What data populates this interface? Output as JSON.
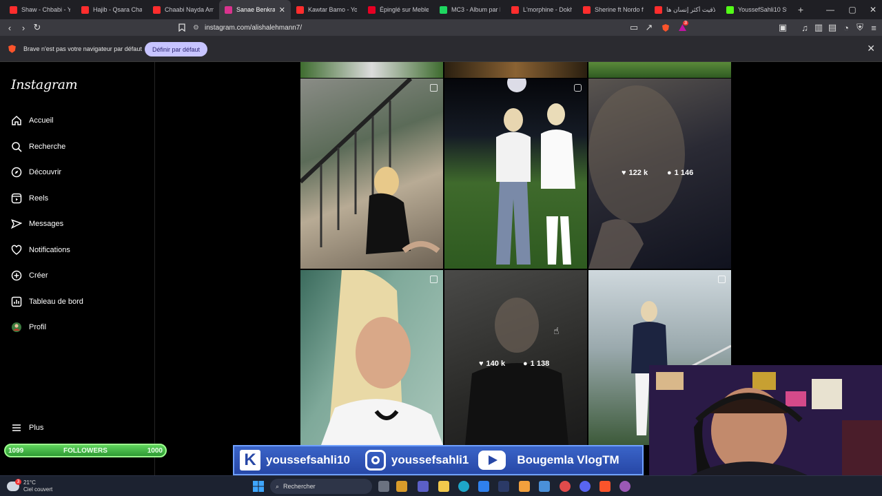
{
  "browser": {
    "tabs": [
      {
        "title": "Shaw - Chbabi - Yo",
        "color": "#ff2d2d"
      },
      {
        "title": "Hajib - Qsara Chaab",
        "color": "#ff2d2d"
      },
      {
        "title": "Chaabi Nayda Amb",
        "color": "#ff2d2d"
      },
      {
        "title": "Sanae Benkrara",
        "color": "#d9338e",
        "active": true
      },
      {
        "title": "Kawtar Bamo - You",
        "color": "#ff2d2d"
      },
      {
        "title": "Épinglé sur Meble i",
        "color": "#e60023"
      },
      {
        "title": "MC3 - Album par L",
        "color": "#1ed760"
      },
      {
        "title": "L'morphine - Dokha",
        "color": "#ff2d2d"
      },
      {
        "title": "Sherine ft Nordo ft",
        "color": "#ff2d2d"
      },
      {
        "title": "تلاقيت أكثر إنسان ها",
        "color": "#ff2d2d"
      },
      {
        "title": "YoussefSahli10 Stre",
        "color": "#53fc18"
      }
    ],
    "url": "instagram.com/alishalehmann7/",
    "notif_count": "3"
  },
  "infobar": {
    "message": "Brave n'est pas votre navigateur par défaut",
    "button": "Définir par défaut"
  },
  "sidebar": {
    "logo": "Instagram",
    "items": [
      {
        "label": "Accueil",
        "icon": "home-icon"
      },
      {
        "label": "Recherche",
        "icon": "search-icon"
      },
      {
        "label": "Découvrir",
        "icon": "compass-icon"
      },
      {
        "label": "Reels",
        "icon": "reels-icon"
      },
      {
        "label": "Messages",
        "icon": "messages-icon"
      },
      {
        "label": "Notifications",
        "icon": "heart-icon"
      },
      {
        "label": "Créer",
        "icon": "plus-icon"
      },
      {
        "label": "Tableau de bord",
        "icon": "dashboard-icon"
      },
      {
        "label": "Profil",
        "icon": "avatar"
      }
    ],
    "more": "Plus"
  },
  "followers_widget": {
    "left": "1099",
    "label": "FOLLOWERS",
    "right": "1000"
  },
  "posts": [
    {
      "likes": "122 k",
      "comments": "1 146"
    },
    {
      "likes": "140 k",
      "comments": "1 138"
    }
  ],
  "overlay": {
    "kick": "youssefsahli10",
    "instagram": "youssefsahli1",
    "youtube": "Bougemla VlogTM"
  },
  "taskbar": {
    "temperature": "21°C",
    "weather": "Ciel couvert",
    "weather_badge": "3",
    "search": "Rechercher"
  }
}
